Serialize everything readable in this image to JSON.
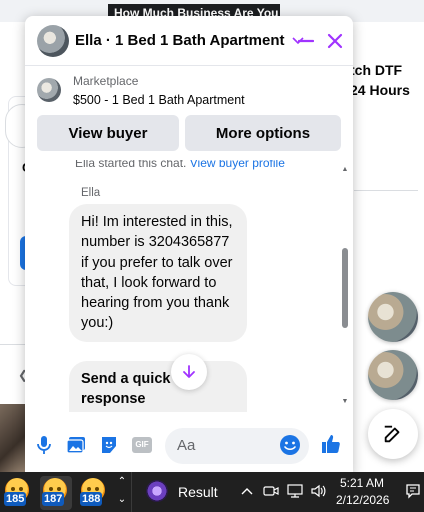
{
  "background": {
    "banner": "How Much Business Are You",
    "side_line1": "tch DTF",
    "side_line2": "24 Hours",
    "left_letter": "C"
  },
  "chat": {
    "title": "Ella · 1 Bed 1 Bath Apartment",
    "marketplace_label": "Marketplace",
    "listing": "$500 - 1 Bed 1 Bath Apartment",
    "view_buyer_label": "View buyer",
    "more_options_label": "More options",
    "system_note": "Ella started this chat. ",
    "system_note_link": "View buyer profile",
    "sender": "Ella",
    "message": "Hi! Im interested in this, number is 3204365877 if you prefer to talk over that, I look forward to hearing from you thank you:)",
    "quick_response": "Send a quick response",
    "composer_placeholder": "Aa"
  },
  "taskbar": {
    "apps": [
      {
        "badge": "185"
      },
      {
        "badge": "187"
      },
      {
        "badge": "188"
      }
    ],
    "result_label": "Result",
    "time": "5:21 AM",
    "date": "2/12/2026"
  },
  "colors": {
    "accent": "#a033ff",
    "link": "#1b74e4",
    "bubble": "#f0f0f0",
    "taskbar": "#202020"
  }
}
